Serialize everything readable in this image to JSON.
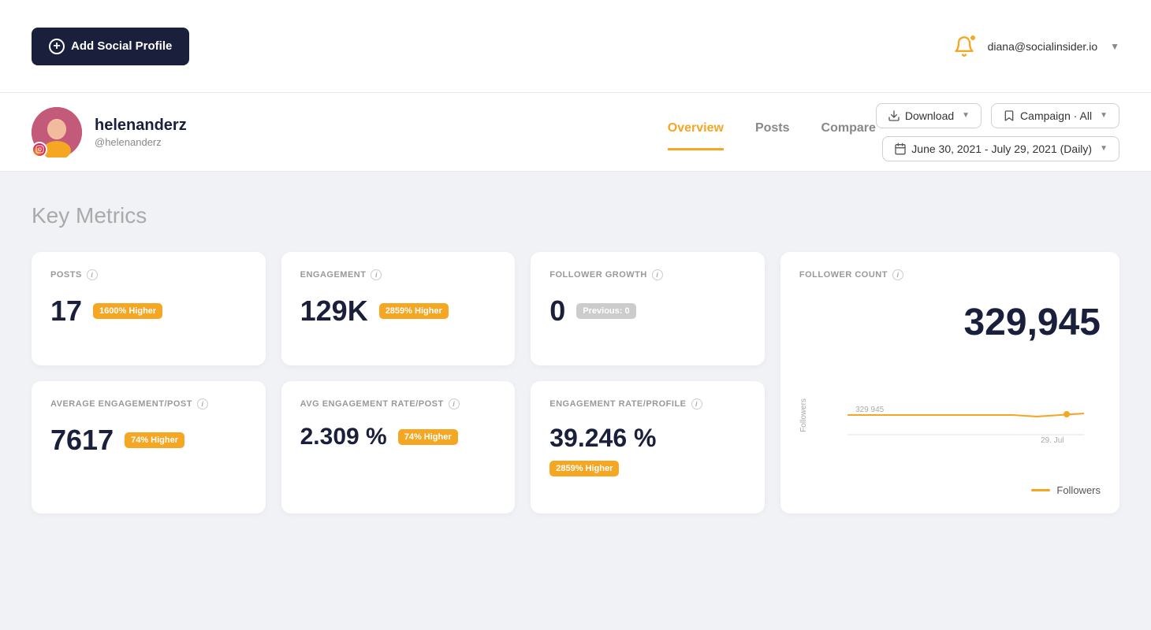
{
  "topNav": {
    "addProfileBtn": "Add Social Profile",
    "userEmail": "diana@socialinsider.io"
  },
  "profileHeader": {
    "name": "helenanderz",
    "handle": "@helenanderz",
    "tabs": [
      {
        "id": "overview",
        "label": "Overview",
        "active": true
      },
      {
        "id": "posts",
        "label": "Posts",
        "active": false
      },
      {
        "id": "compare",
        "label": "Compare",
        "active": false
      }
    ],
    "downloadBtn": "Download",
    "campaignBtn": "Campaign · All",
    "dateRangeBtn": "June 30, 2021 - July 29, 2021 (Daily)"
  },
  "keyMetrics": {
    "sectionTitle": "Key Metrics",
    "cards": [
      {
        "id": "posts",
        "label": "POSTS",
        "value": "17",
        "badge": "1600% Higher",
        "badgeType": "orange"
      },
      {
        "id": "engagement",
        "label": "ENGAGEMENT",
        "value": "129K",
        "badge": "2859% Higher",
        "badgeType": "orange"
      },
      {
        "id": "followerGrowth",
        "label": "FOLLOWER GROWTH",
        "value": "0",
        "badge": "Previous: 0",
        "badgeType": "gray"
      },
      {
        "id": "avgEngagementPost",
        "label": "AVERAGE ENGAGEMENT/POST",
        "value": "7617",
        "badge": "74% Higher",
        "badgeType": "orange"
      },
      {
        "id": "avgEngagementRatePost",
        "label": "AVG ENGAGEMENT RATE/POST",
        "value": "2.309 %",
        "badge": "74% Higher",
        "badgeType": "orange"
      },
      {
        "id": "engagementRateProfile",
        "label": "ENGAGEMENT RATE/PROFILE",
        "value": "39.246 %",
        "badge": "2859% Higher",
        "badgeType": "orange"
      }
    ],
    "followerCount": {
      "label": "FOLLOWER COUNT",
      "value": "329,945",
      "chartYLabel": "Followers",
      "chartDataLabel": "329 945",
      "chartXLabel": "29. Jul",
      "legendLabel": "Followers"
    }
  }
}
